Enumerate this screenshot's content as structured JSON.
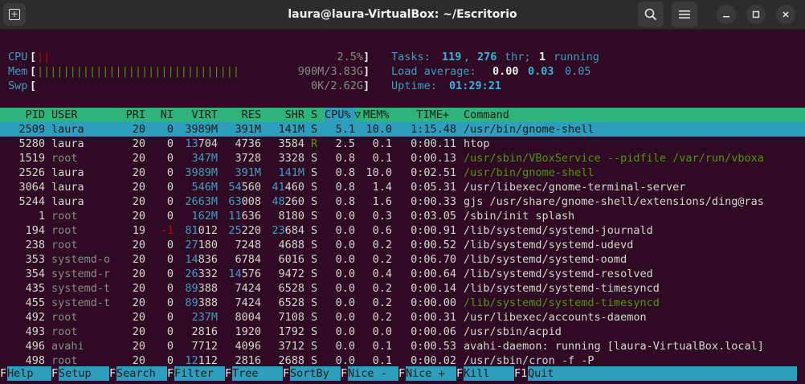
{
  "window": {
    "title": "laura@laura-VirtualBox: ~/Escritorio"
  },
  "meters": {
    "cpu": {
      "label": "CPU",
      "bar": "||",
      "value": "2.5%"
    },
    "mem": {
      "label": "Mem",
      "bar": "|||||||||||||||||||||||||||||||",
      "value": "900M/3.83G"
    },
    "swp": {
      "label": "Swp",
      "bar": "",
      "value": "0K/2.62G"
    }
  },
  "summary": {
    "tasks_label": "Tasks:",
    "tasks": "119",
    "threads": "276",
    "thr_label": "thr;",
    "running": "1",
    "running_label": "running",
    "load_label": "Load average:",
    "load1": "0.00",
    "load5": "0.03",
    "load15": "0.05",
    "uptime_label": "Uptime:",
    "uptime": "01:29:21"
  },
  "columns": [
    "PID",
    "USER",
    "PRI",
    "NI",
    "VIRT",
    "RES",
    "SHR",
    "S",
    "CPU%",
    "MEM%",
    "TIME+",
    "Command"
  ],
  "sort_indicator": "▽",
  "processes": [
    {
      "pid": "2509",
      "user": "laura",
      "pri": "20",
      "ni": "0",
      "virt": "3989M",
      "res": "391M",
      "shr": "141M",
      "s": "S",
      "cpu": "5.1",
      "mem": "10.0",
      "time": "1:15.48",
      "cmd": "/usr/bin/gnome-shell",
      "sel": true
    },
    {
      "pid": "5280",
      "user": "laura",
      "pri": "20",
      "ni": "0",
      "virt": "13704",
      "res": "4736",
      "shr": "3584",
      "s": "R",
      "cpu": "2.5",
      "mem": "0.1",
      "time": "0:00.11",
      "cmd": "htop"
    },
    {
      "pid": "1519",
      "user": "root",
      "pri": "20",
      "ni": "0",
      "virt": "347M",
      "res": "3728",
      "shr": "3328",
      "s": "S",
      "cpu": "0.8",
      "mem": "0.1",
      "time": "0:00.13",
      "cmd": "/usr/sbin/VBoxService --pidfile /var/run/vboxa",
      "thread": true
    },
    {
      "pid": "2526",
      "user": "laura",
      "pri": "20",
      "ni": "0",
      "virt": "3989M",
      "res": "391M",
      "shr": "141M",
      "s": "S",
      "cpu": "0.8",
      "mem": "10.0",
      "time": "0:02.51",
      "cmd": "/usr/bin/gnome-shell",
      "thread": true
    },
    {
      "pid": "3064",
      "user": "laura",
      "pri": "20",
      "ni": "0",
      "virt": "546M",
      "res": "54560",
      "shr": "41460",
      "s": "S",
      "cpu": "0.8",
      "mem": "1.4",
      "time": "0:05.31",
      "cmd": "/usr/libexec/gnome-terminal-server"
    },
    {
      "pid": "5244",
      "user": "laura",
      "pri": "20",
      "ni": "0",
      "virt": "2663M",
      "res": "63008",
      "shr": "48260",
      "s": "S",
      "cpu": "0.8",
      "mem": "1.6",
      "time": "0:00.33",
      "cmd": "gjs /usr/share/gnome-shell/extensions/ding@ras"
    },
    {
      "pid": "1",
      "user": "root",
      "pri": "20",
      "ni": "0",
      "virt": "162M",
      "res": "11636",
      "shr": "8180",
      "s": "S",
      "cpu": "0.0",
      "mem": "0.3",
      "time": "0:03.05",
      "cmd": "/sbin/init splash"
    },
    {
      "pid": "194",
      "user": "root",
      "pri": "19",
      "ni": "-1",
      "virt": "81012",
      "res": "25220",
      "shr": "23684",
      "s": "S",
      "cpu": "0.0",
      "mem": "0.6",
      "time": "0:00.91",
      "cmd": "/lib/systemd/systemd-journald"
    },
    {
      "pid": "238",
      "user": "root",
      "pri": "20",
      "ni": "0",
      "virt": "27180",
      "res": "7248",
      "shr": "4688",
      "s": "S",
      "cpu": "0.0",
      "mem": "0.2",
      "time": "0:00.52",
      "cmd": "/lib/systemd/systemd-udevd"
    },
    {
      "pid": "353",
      "user": "systemd-o",
      "pri": "20",
      "ni": "0",
      "virt": "14836",
      "res": "6784",
      "shr": "6016",
      "s": "S",
      "cpu": "0.0",
      "mem": "0.2",
      "time": "0:06.70",
      "cmd": "/lib/systemd/systemd-oomd"
    },
    {
      "pid": "354",
      "user": "systemd-r",
      "pri": "20",
      "ni": "0",
      "virt": "26332",
      "res": "14576",
      "shr": "9472",
      "s": "S",
      "cpu": "0.0",
      "mem": "0.4",
      "time": "0:00.64",
      "cmd": "/lib/systemd/systemd-resolved"
    },
    {
      "pid": "435",
      "user": "systemd-t",
      "pri": "20",
      "ni": "0",
      "virt": "89388",
      "res": "7424",
      "shr": "6528",
      "s": "S",
      "cpu": "0.0",
      "mem": "0.2",
      "time": "0:00.14",
      "cmd": "/lib/systemd/systemd-timesyncd"
    },
    {
      "pid": "455",
      "user": "systemd-t",
      "pri": "20",
      "ni": "0",
      "virt": "89388",
      "res": "7424",
      "shr": "6528",
      "s": "S",
      "cpu": "0.0",
      "mem": "0.2",
      "time": "0:00.00",
      "cmd": "/lib/systemd/systemd-timesyncd",
      "thread": true
    },
    {
      "pid": "492",
      "user": "root",
      "pri": "20",
      "ni": "0",
      "virt": "237M",
      "res": "8004",
      "shr": "7108",
      "s": "S",
      "cpu": "0.0",
      "mem": "0.2",
      "time": "0:00.31",
      "cmd": "/usr/libexec/accounts-daemon"
    },
    {
      "pid": "493",
      "user": "root",
      "pri": "20",
      "ni": "0",
      "virt": "2816",
      "res": "1920",
      "shr": "1792",
      "s": "S",
      "cpu": "0.0",
      "mem": "0.0",
      "time": "0:00.06",
      "cmd": "/usr/sbin/acpid"
    },
    {
      "pid": "496",
      "user": "avahi",
      "pri": "20",
      "ni": "0",
      "virt": "7712",
      "res": "4096",
      "shr": "3712",
      "s": "S",
      "cpu": "0.0",
      "mem": "0.1",
      "time": "0:00.53",
      "cmd": "avahi-daemon: running [laura-VirtualBox.local]"
    },
    {
      "pid": "498",
      "user": "root",
      "pri": "20",
      "ni": "0",
      "virt": "12112",
      "res": "2816",
      "shr": "2688",
      "s": "S",
      "cpu": "0.0",
      "mem": "0.1",
      "time": "0:00.02",
      "cmd": "/usr/sbin/cron -f -P"
    }
  ],
  "footer": [
    {
      "key": "F1",
      "label": "Help"
    },
    {
      "key": "F2",
      "label": "Setup"
    },
    {
      "key": "F3",
      "label": "Search"
    },
    {
      "key": "F4",
      "label": "Filter"
    },
    {
      "key": "F5",
      "label": "Tree"
    },
    {
      "key": "F6",
      "label": "SortBy"
    },
    {
      "key": "F7",
      "label": "Nice -"
    },
    {
      "key": "F8",
      "label": "Nice +"
    },
    {
      "key": "F9",
      "label": "Kill"
    },
    {
      "key": "F10",
      "label": "Quit"
    }
  ],
  "colors": {
    "background": "#300a24",
    "header_bg": "#2eb37a",
    "selection_bg": "#2d9fbc"
  }
}
